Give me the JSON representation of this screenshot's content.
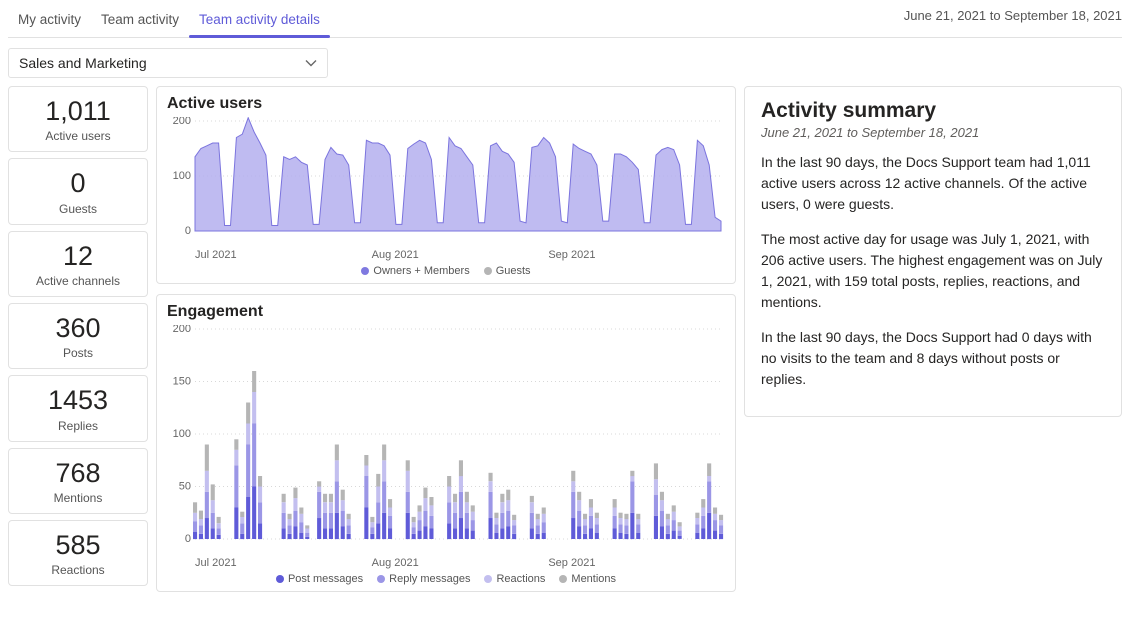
{
  "header": {
    "tabs": [
      "My activity",
      "Team activity",
      "Team activity details"
    ],
    "active_tab": 2,
    "date_range": "June 21, 2021 to September 18, 2021"
  },
  "dropdown": {
    "value": "Sales and Marketing"
  },
  "stats": [
    {
      "value": "1,011",
      "label": "Active users"
    },
    {
      "value": "0",
      "label": "Guests"
    },
    {
      "value": "12",
      "label": "Active channels"
    },
    {
      "value": "360",
      "label": "Posts"
    },
    {
      "value": "1453",
      "label": "Replies"
    },
    {
      "value": "768",
      "label": "Mentions"
    },
    {
      "value": "585",
      "label": "Reactions"
    }
  ],
  "summary": {
    "title": "Activity summary",
    "subtitle": "June 21, 2021 to September 18, 2021",
    "paras": [
      "In the last 90 days, the Docs Support team had 1,011 active users across 12 active channels. Of the active users, 0 were guests.",
      "The most active day for usage was July 1, 2021, with 206 active users. The highest engagement was on July 1, 2021, with 159 total posts, replies, reactions, and mentions.",
      "In the last 90 days, the Docs Support had 0 days with no visits to the team and 8 days without posts or replies."
    ]
  },
  "chart_data": [
    {
      "type": "area",
      "title": "Active users",
      "ylabel": "",
      "xlabel": "",
      "ylim": [
        0,
        200
      ],
      "xticks": [
        "Jul 2021",
        "Aug 2021",
        "Sep 2021"
      ],
      "legend": [
        {
          "name": "Owners + Members",
          "color": "#7f79e0"
        },
        {
          "name": "Guests",
          "color": "#b5b5b5"
        }
      ],
      "series": [
        {
          "name": "Owners + Members",
          "values": [
            135,
            150,
            155,
            160,
            160,
            10,
            10,
            170,
            176,
            206,
            180,
            160,
            138,
            10,
            10,
            135,
            130,
            135,
            125,
            120,
            12,
            12,
            130,
            152,
            140,
            138,
            120,
            15,
            15,
            165,
            160,
            160,
            155,
            138,
            12,
            12,
            150,
            158,
            165,
            160,
            130,
            15,
            15,
            170,
            155,
            150,
            135,
            120,
            15,
            15,
            155,
            160,
            145,
            140,
            125,
            18,
            15,
            152,
            155,
            170,
            160,
            135,
            18,
            15,
            158,
            150,
            145,
            140,
            120,
            18,
            18,
            140,
            140,
            135,
            125,
            112,
            15,
            15,
            138,
            148,
            152,
            148,
            120,
            12,
            12,
            165,
            155,
            120,
            25,
            18
          ]
        },
        {
          "name": "Guests",
          "values": [
            0,
            0,
            0,
            0,
            0,
            0,
            0,
            0,
            0,
            0,
            0,
            0,
            0,
            0,
            0,
            0,
            0,
            0,
            0,
            0,
            0,
            0,
            0,
            0,
            0,
            0,
            0,
            0,
            0,
            0,
            0,
            0,
            0,
            0,
            0,
            0,
            0,
            0,
            0,
            0,
            0,
            0,
            0,
            0,
            0,
            0,
            0,
            0,
            0,
            0,
            0,
            0,
            0,
            0,
            0,
            0,
            0,
            0,
            0,
            0,
            0,
            0,
            0,
            0,
            0,
            0,
            0,
            0,
            0,
            0,
            0,
            0,
            0,
            0,
            0,
            0,
            0,
            0,
            0,
            0,
            0,
            0,
            0,
            0,
            0,
            0,
            0,
            0,
            0,
            0
          ]
        }
      ]
    },
    {
      "type": "bar",
      "title": "Engagement",
      "ylabel": "",
      "xlabel": "",
      "ylim": [
        0,
        200
      ],
      "xticks": [
        "Jul 2021",
        "Aug 2021",
        "Sep 2021"
      ],
      "legend": [
        {
          "name": "Post messages",
          "color": "#5f5bd8"
        },
        {
          "name": "Reply messages",
          "color": "#9b96e6"
        },
        {
          "name": "Reactions",
          "color": "#c3bfef"
        },
        {
          "name": "Mentions",
          "color": "#b5b5b5"
        }
      ],
      "series": [
        {
          "name": "Post messages",
          "values": [
            7,
            5,
            20,
            10,
            4,
            0,
            0,
            30,
            5,
            40,
            50,
            15,
            0,
            0,
            0,
            10,
            5,
            12,
            6,
            2,
            0,
            20,
            10,
            10,
            25,
            12,
            5,
            0,
            0,
            30,
            5,
            15,
            25,
            10,
            0,
            0,
            25,
            5,
            8,
            12,
            10,
            0,
            0,
            15,
            10,
            20,
            10,
            8,
            0,
            0,
            20,
            6,
            10,
            12,
            5,
            0,
            0,
            10,
            5,
            6,
            0,
            0,
            0,
            0,
            20,
            12,
            5,
            10,
            6,
            0,
            0,
            10,
            6,
            5,
            25,
            6,
            0,
            0,
            22,
            12,
            5,
            8,
            3,
            0,
            0,
            6,
            10,
            25,
            8,
            5
          ]
        },
        {
          "name": "Reply messages",
          "values": [
            10,
            8,
            25,
            15,
            6,
            0,
            0,
            40,
            10,
            50,
            60,
            20,
            0,
            0,
            0,
            15,
            8,
            15,
            10,
            4,
            0,
            25,
            15,
            15,
            30,
            15,
            8,
            0,
            0,
            30,
            6,
            20,
            30,
            12,
            0,
            0,
            20,
            6,
            10,
            15,
            12,
            0,
            0,
            20,
            15,
            25,
            15,
            10,
            0,
            0,
            25,
            8,
            15,
            15,
            8,
            0,
            0,
            15,
            8,
            10,
            0,
            0,
            0,
            0,
            25,
            15,
            8,
            12,
            8,
            0,
            0,
            12,
            8,
            8,
            30,
            8,
            0,
            0,
            20,
            15,
            8,
            10,
            5,
            0,
            0,
            8,
            12,
            30,
            10,
            8
          ]
        },
        {
          "name": "Reactions",
          "values": [
            8,
            6,
            20,
            12,
            5,
            0,
            0,
            15,
            6,
            20,
            30,
            15,
            0,
            0,
            0,
            10,
            6,
            12,
            8,
            4,
            0,
            5,
            10,
            10,
            20,
            10,
            6,
            0,
            0,
            10,
            5,
            15,
            20,
            8,
            0,
            0,
            20,
            5,
            8,
            12,
            10,
            0,
            0,
            15,
            10,
            15,
            10,
            8,
            0,
            0,
            10,
            6,
            10,
            10,
            5,
            0,
            0,
            10,
            6,
            8,
            0,
            0,
            0,
            0,
            10,
            10,
            6,
            8,
            6,
            0,
            0,
            8,
            6,
            6,
            5,
            5,
            0,
            0,
            15,
            10,
            6,
            8,
            4,
            0,
            0,
            6,
            8,
            5,
            6,
            5
          ]
        },
        {
          "name": "Mentions",
          "values": [
            10,
            8,
            25,
            15,
            6,
            0,
            0,
            10,
            5,
            20,
            20,
            10,
            0,
            0,
            0,
            8,
            5,
            10,
            6,
            3,
            0,
            5,
            8,
            8,
            15,
            10,
            5,
            0,
            0,
            10,
            5,
            12,
            15,
            8,
            0,
            0,
            10,
            5,
            6,
            10,
            8,
            0,
            0,
            10,
            8,
            15,
            10,
            6,
            0,
            0,
            8,
            5,
            8,
            10,
            5,
            0,
            0,
            6,
            5,
            6,
            0,
            0,
            0,
            0,
            10,
            8,
            5,
            8,
            5,
            0,
            0,
            8,
            5,
            5,
            5,
            5,
            0,
            0,
            15,
            8,
            5,
            6,
            4,
            0,
            0,
            5,
            8,
            12,
            6,
            5
          ]
        }
      ]
    }
  ]
}
